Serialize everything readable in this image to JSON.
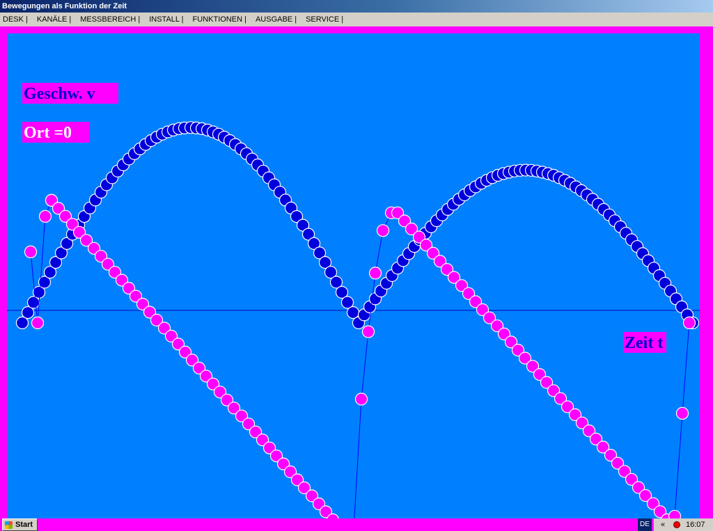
{
  "window": {
    "title": "Bewegungen als Funktion der Zeit"
  },
  "menu": [
    "DESK |",
    "KANÄLE |",
    "MESSBEREICH |",
    "INSTALL |",
    "FUNKTIONEN |",
    "AUSGABE |",
    "SERVICE |"
  ],
  "taskbar": {
    "start_label": "Start",
    "language": "DE",
    "chevron": "«",
    "clock": "16:07"
  },
  "colors": {
    "background": "#ff00ff",
    "plot_area": "#0080ff",
    "velocity": "#0000dd",
    "position": "#ff00ff",
    "axis": "#0000c0"
  },
  "chart_data": {
    "type": "scatter",
    "title": "",
    "xlabel": "Zeit t",
    "ylabel": "",
    "xlim": [
      0,
      1
    ],
    "ylim": [
      -1,
      1
    ],
    "grid": false,
    "legend": "top-left",
    "series": [
      {
        "name": "Geschw. v",
        "color": "#0000dd",
        "values": []
      },
      {
        "name": "Ort =0",
        "color": "#ff00ff",
        "values": []
      }
    ]
  }
}
